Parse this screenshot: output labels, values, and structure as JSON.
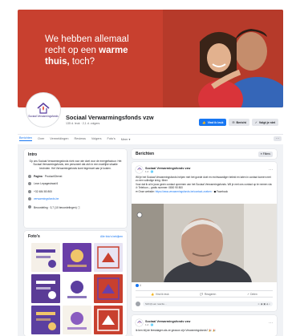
{
  "cover": {
    "headline_line1": "We hebben allemaal",
    "headline_line2_a": "recht op een ",
    "headline_line2_b": "warme",
    "headline_line3_a": "thuis,",
    "headline_line3_b": " toch?",
    "background_color": "#c8402f"
  },
  "page": {
    "logo_text": "Sociaal Verwarmingsfonds",
    "name": "Sociaal Verwarmingsfonds vzw",
    "subtitle": "135 d. leuk · 2,1 d. volgers",
    "actions": [
      {
        "label": "Vind ik leuk",
        "icon": "thumbs-up-icon",
        "primary": true
      },
      {
        "label": "Bericht",
        "icon": "messenger-icon",
        "primary": false
      },
      {
        "label": "Volgt je niet",
        "icon": "follow-icon",
        "primary": false
      }
    ]
  },
  "tabs": [
    {
      "label": "Berichten",
      "active": true
    },
    {
      "label": "Over",
      "active": false
    },
    {
      "label": "Vermeldingen",
      "active": false
    },
    {
      "label": "Reviews",
      "active": false
    },
    {
      "label": "Volgers",
      "active": false
    },
    {
      "label": "Foto's",
      "active": false
    },
    {
      "label": "Meer ▾",
      "active": false
    }
  ],
  "tabs_more": "···",
  "intro": {
    "title": "Intro",
    "text": "Op ons Sociaal Verwarmingsfonds richt voor wie doet voor de energiefactuur. Het Sociaal Verwarmingsfonds, een personeel dat zich in een moeilijke situatie bevinden. Het Verwarmingsfonds komt tegemoet aan je kosten.",
    "rows": [
      {
        "icon": "info-icon",
        "bold": "Pagina",
        "text": " · Product/Dienst"
      },
      {
        "icon": "location-icon",
        "bold": "",
        "text": "Leon Lepagestraat 6"
      },
      {
        "icon": "phone-icon",
        "bold": "",
        "text": "+32 484 80 800"
      },
      {
        "icon": "web-icon",
        "bold": "",
        "text": "verwarmingsfonds.be",
        "link": true
      },
      {
        "icon": "rating-icon",
        "bold": "",
        "text": "Beoordeling · 3,7 (10 beoordelingen) ⓘ"
      }
    ]
  },
  "photos": {
    "title": "Foto's",
    "see_all": "Alle foto's bekijken",
    "tiles": [
      {
        "color": "#f5f0e8",
        "accent": "#5b3fa0"
      },
      {
        "color": "#6a3fa8",
        "accent": "#f0c56a"
      },
      {
        "color": "#e8e4f3",
        "accent": "#c8402f"
      },
      {
        "color": "#5a3b96",
        "accent": "#ffffff"
      },
      {
        "color": "#ffffff",
        "accent": "#5b3fa0"
      },
      {
        "color": "#c8402f",
        "accent": "#6a3fa8"
      },
      {
        "color": "#5b3fa0",
        "accent": "#f0c56a"
      },
      {
        "color": "#f6f2ea",
        "accent": "#8a5cc0"
      },
      {
        "color": "#c8402f",
        "accent": "#ffffff"
      }
    ]
  },
  "posts_header": {
    "title": "Berichten",
    "filter_label": "≡ Filters"
  },
  "post1": {
    "author": "Sociaal Verwarmingsfonds vzw",
    "time": "1 d · 🌐",
    "dots": "···",
    "text_1": "Wil je het Sociaal Verwarmingsfonds helpen met het goede doel en rechtvaardiger beleid en laten in contact komen met zo een volledige kring. Meer",
    "text_2": "Voor dat ik al in jouw gezin contact opnemen van het Sociaal Verwarmingsfonds. Wil je met ons contact op te nemen via:",
    "text_3": "✆ Telefoon – gratis nummer: 0800 90 800",
    "text_4_a": "✉ Onze website: ",
    "text_4_link": "https://www.verwarmingsfonds.be/contact-zoeken",
    "text_4_b": " · ◼ Facebook",
    "reaction_count": "4",
    "actions": [
      {
        "label": "Vind ik leuk",
        "icon": "like-icon"
      },
      {
        "label": "Reageren",
        "icon": "comment-icon"
      },
      {
        "label": "Delen",
        "icon": "share-icon"
      }
    ],
    "comment_placeholder": "Schrijf een reactie…",
    "comment_tools": "☺ ◉ ▣ ◈ ◐"
  },
  "post2": {
    "author": "Sociaal Verwarmingsfonds vzw",
    "time": "1 d · 🌐",
    "dots": "···",
    "text": "Ik ben blij de feestdagen als ze gewoon zijn Verwarmingsfonds? 🎉 🎉"
  }
}
